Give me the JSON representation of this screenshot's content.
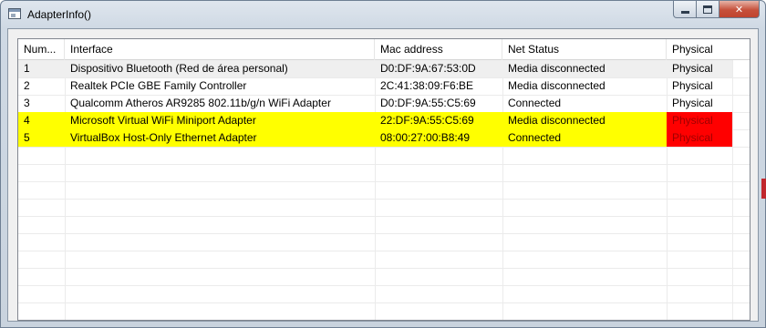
{
  "window": {
    "title": "AdapterInfo()",
    "controls": {
      "minimize": "minimize-icon",
      "maximize": "maximize-icon",
      "close": "close-icon"
    }
  },
  "table": {
    "columns": [
      "Num...",
      "Interface",
      "Mac address",
      "Net Status",
      "Physical"
    ],
    "rows": [
      {
        "num": "1",
        "interface": "Dispositivo Bluetooth (Red de área personal)",
        "mac": "D0:DF:9A:67:53:0D",
        "status": "Media disconnected",
        "physical": "Physical",
        "highlight": false
      },
      {
        "num": "2",
        "interface": "Realtek PCIe GBE Family Controller",
        "mac": "2C:41:38:09:F6:BE",
        "status": "Media disconnected",
        "physical": "Physical",
        "highlight": false
      },
      {
        "num": "3",
        "interface": "Qualcomm Atheros AR9285 802.11b/g/n WiFi Adapter",
        "mac": "D0:DF:9A:55:C5:69",
        "status": "Connected",
        "physical": "Physical",
        "highlight": false
      },
      {
        "num": "4",
        "interface": "Microsoft Virtual WiFi Miniport Adapter",
        "mac": "22:DF:9A:55:C5:69",
        "status": "Media disconnected",
        "physical": "Physical",
        "highlight": true
      },
      {
        "num": "5",
        "interface": "VirtualBox Host-Only Ethernet Adapter",
        "mac": "08:00:27:00:B8:49",
        "status": "Connected",
        "physical": "Physical",
        "highlight": true
      }
    ]
  },
  "colors": {
    "highlight_row": "#ffff00",
    "physical_flag": "#ff0000",
    "first_row": "#efefef"
  }
}
